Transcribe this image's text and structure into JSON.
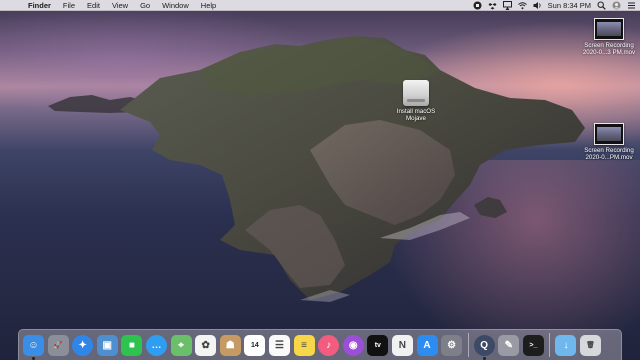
{
  "menubar": {
    "apple_icon": "apple-logo-icon",
    "items": [
      "Finder",
      "File",
      "Edit",
      "View",
      "Go",
      "Window",
      "Help"
    ],
    "status": {
      "clock": "Sun 8:34 PM",
      "icons": [
        "record-stop-icon",
        "dropbox-icon",
        "airplay-icon",
        "wifi-icon",
        "volume-icon",
        "search-icon",
        "user-icon",
        "menu-list-icon"
      ]
    }
  },
  "desktop_icons": [
    {
      "label": "Install macOS Mojave",
      "icon": "disk-image-icon"
    },
    {
      "label": "Screen Recording 2020-0...3 PM.mov",
      "icon": "movie-file-icon"
    },
    {
      "label": "Screen Recording 2020-0...PM.mov",
      "icon": "movie-file-icon"
    }
  ],
  "dock": {
    "apps": [
      {
        "name": "Finder",
        "icon": "finder-icon",
        "color": "#3a8ee6",
        "glyph": "☺",
        "running": true
      },
      {
        "name": "Launchpad",
        "icon": "launchpad-rocket-icon",
        "color": "#8a8f99",
        "glyph": "🚀",
        "running": false
      },
      {
        "name": "Safari",
        "icon": "safari-compass-icon",
        "color": "#2f86e8",
        "glyph": "✦",
        "running": false
      },
      {
        "name": "Image Capture",
        "icon": "photo-icon",
        "color": "#4d8fcf",
        "glyph": "▣",
        "running": false
      },
      {
        "name": "FaceTime",
        "icon": "facetime-icon",
        "color": "#2ec24f",
        "glyph": "■",
        "running": false
      },
      {
        "name": "Messages",
        "icon": "messages-bubble-icon",
        "color": "#2f9df0",
        "glyph": "…",
        "running": false
      },
      {
        "name": "Maps",
        "icon": "maps-icon",
        "color": "#6bbf6a",
        "glyph": "⌖",
        "running": false
      },
      {
        "name": "Photos",
        "icon": "photos-flower-icon",
        "color": "#f4f4f4",
        "glyph": "✿",
        "running": false
      },
      {
        "name": "Contacts",
        "icon": "contacts-book-icon",
        "color": "#c59a63",
        "glyph": "☗",
        "running": false
      },
      {
        "name": "Calendar",
        "icon": "calendar-icon",
        "color": "#ffffff",
        "glyph": "14",
        "running": false
      },
      {
        "name": "Reminders",
        "icon": "reminders-list-icon",
        "color": "#fafafa",
        "glyph": "☰",
        "running": false
      },
      {
        "name": "Notes",
        "icon": "notes-icon",
        "color": "#f7d64a",
        "glyph": "≡",
        "running": false
      },
      {
        "name": "Music",
        "icon": "music-note-icon",
        "color": "#f25c7e",
        "glyph": "♪",
        "running": false
      },
      {
        "name": "Podcasts",
        "icon": "podcasts-icon",
        "color": "#9a4fd6",
        "glyph": "◉",
        "running": false
      },
      {
        "name": "TV",
        "icon": "apple-tv-icon",
        "color": "#111111",
        "glyph": "tv",
        "running": false
      },
      {
        "name": "News",
        "icon": "news-icon",
        "color": "#f1f1f1",
        "glyph": "N",
        "running": false
      },
      {
        "name": "App Store",
        "icon": "app-store-icon",
        "color": "#2d8cf0",
        "glyph": "A",
        "running": false
      },
      {
        "name": "System Preferences",
        "icon": "gear-icon",
        "color": "#7d8088",
        "glyph": "⚙",
        "running": false
      }
    ],
    "tools": [
      {
        "name": "QuickTime Player",
        "icon": "quicktime-icon",
        "color": "#3d4a66",
        "glyph": "Q",
        "running": true
      },
      {
        "name": "Script Editor",
        "icon": "script-editor-icon",
        "color": "#9a9aa4",
        "glyph": "✎",
        "running": false
      },
      {
        "name": "Terminal",
        "icon": "terminal-icon",
        "color": "#1d1d1d",
        "glyph": ">_",
        "running": false
      }
    ],
    "right": [
      {
        "name": "Downloads",
        "icon": "downloads-folder-icon",
        "color": "#6fb8ee",
        "glyph": "↓",
        "running": false
      },
      {
        "name": "Trash",
        "icon": "trash-icon",
        "color": "#d6d8dc",
        "glyph": "🗑",
        "running": false
      }
    ]
  }
}
